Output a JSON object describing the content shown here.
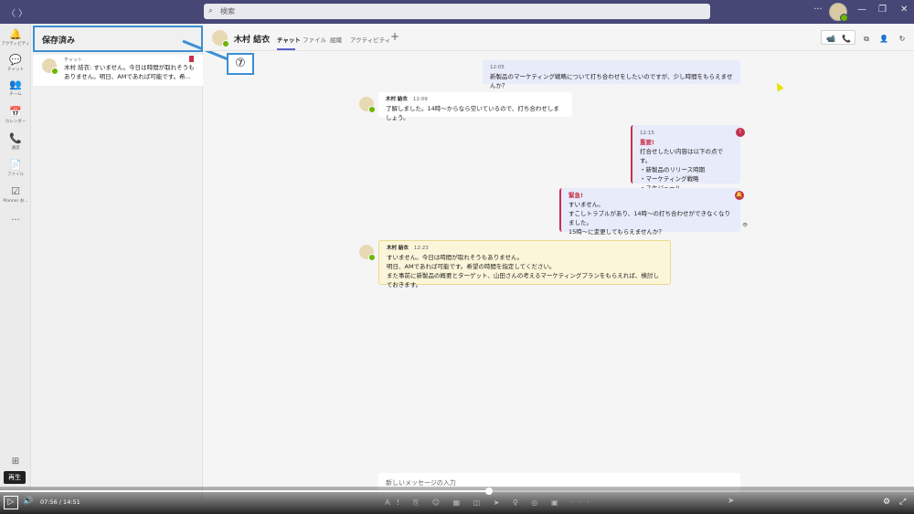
{
  "titlebar": {
    "back": "〈",
    "forward": "〉",
    "search_placeholder": "検索",
    "more": "···",
    "minimize": "—",
    "restore": "❐",
    "close": "✕"
  },
  "rail": {
    "items": [
      {
        "icon": "🔔",
        "label": "アクティビティ"
      },
      {
        "icon": "💬",
        "label": "チャット"
      },
      {
        "icon": "👥",
        "label": "チーム"
      },
      {
        "icon": "📅",
        "label": "カレンダー"
      },
      {
        "icon": "📞",
        "label": "通話"
      },
      {
        "icon": "📄",
        "label": "ファイル"
      },
      {
        "icon": "☑",
        "label": "Planner お..."
      }
    ],
    "more": "···",
    "apps": "⊞"
  },
  "sidebar": {
    "title": "保存済み",
    "saved_item": {
      "source": "チャット",
      "message": "木村 結衣: すいません。今日は時間が取れそうもありません。明日、AMであれば可能です。希..."
    }
  },
  "callout": {
    "number": "⑦"
  },
  "chat": {
    "contact_name": "木村 結衣",
    "tabs": [
      "チャット",
      "ファイル",
      "組織",
      "アクティビティ"
    ],
    "add_tab": "+",
    "header_icons": [
      "📹",
      "📞",
      "⧉",
      "👤",
      "↻"
    ],
    "messages": [
      {
        "time": "12:05",
        "text": "新製品のマーケティング戦略について打ち合わせをしたいのですが、少し時間をもらえませんか？"
      },
      {
        "sender": "木村 結衣",
        "time": "12:09",
        "text": "了解しました。14時～からなら空いているので、打ち合わせしましょう。"
      },
      {
        "time": "12:15",
        "tag": "重要!",
        "badge": "!",
        "lines": [
          "打合せしたい内容は以下の点です。",
          "・新製品のリリース時期",
          "・マーケティング戦略",
          "・スケジュール"
        ]
      },
      {
        "tag": "緊急!",
        "badge": "🔔",
        "lines": [
          "すいません。",
          "すこしトラブルがあり、14時～の打ち合わせができなくなりました。",
          "15時～に変更してもらえませんか？"
        ],
        "seen": "👁"
      },
      {
        "sender": "木村 結衣",
        "time": "12:23",
        "lines": [
          "すいません。今日は時間が取れそうもありません。",
          "明日、AMであれば可能です。希望の時間を指定してください。",
          "また事前に新製品の概要とターゲット、山田さんの考えるマーケティングプランをもらえれば、検討しておきます。"
        ]
      }
    ],
    "compose_placeholder": "新しいメッセージの入力",
    "compose_tools": "Ａ! ⎘ ☺ ▦ ◫ ➤ ♀ ◎ ▣ ···",
    "send": "➤"
  },
  "player": {
    "tooltip": "再生",
    "play": "▷",
    "volume": "🔊",
    "time": "07:56 / 14:51",
    "progress": 0.535,
    "settings": "⚙",
    "fullscreen": "⤢"
  }
}
